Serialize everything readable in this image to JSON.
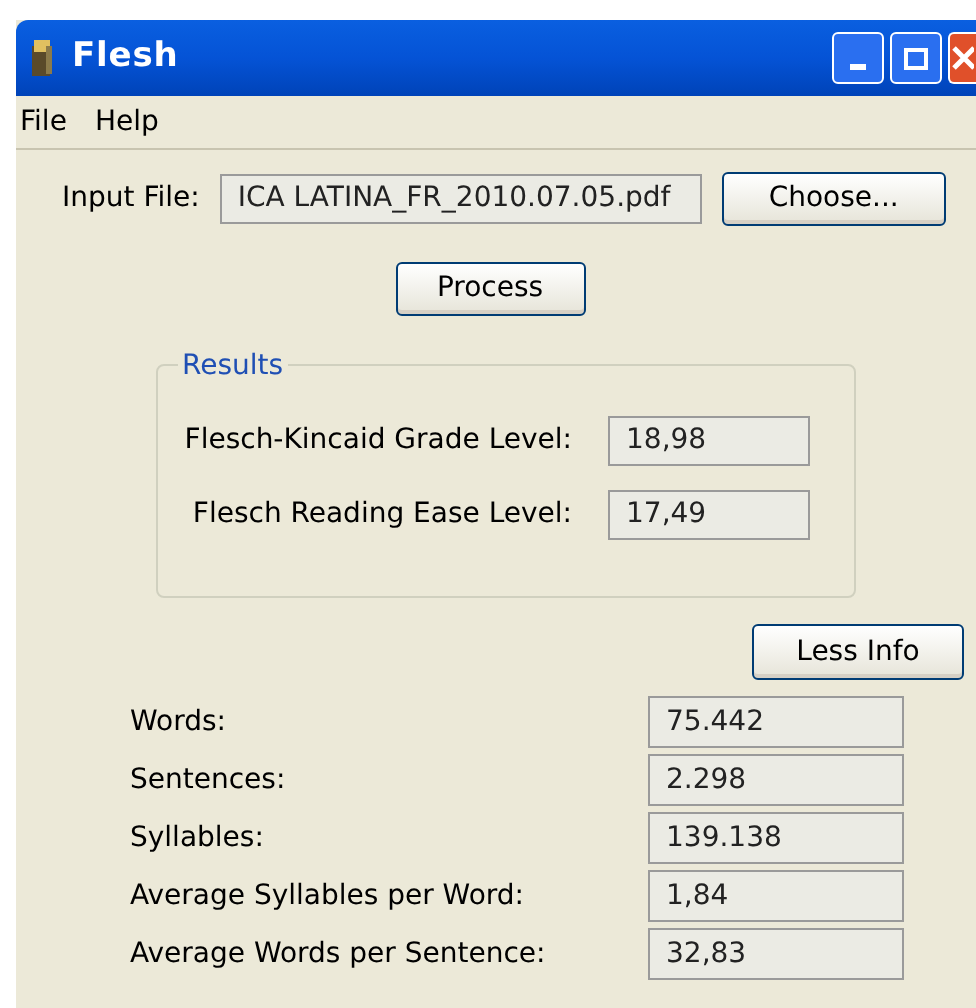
{
  "window": {
    "title": "Flesh"
  },
  "menu": [
    "File",
    "Help"
  ],
  "input_file": {
    "label": "Input File:",
    "value": "ICA LATINA_FR_2010.07.05.pdf",
    "button": "Choose..."
  },
  "process_button": "Process",
  "results": {
    "title": "Results",
    "rows": [
      {
        "label": "Flesch-Kincaid Grade Level:",
        "value": "18,98"
      },
      {
        "label": "Flesch Reading Ease Level:",
        "value": "17,49"
      }
    ]
  },
  "info_button": "Less Info",
  "stats": [
    {
      "label": "Words:",
      "value": "75.442"
    },
    {
      "label": "Sentences:",
      "value": "2.298"
    },
    {
      "label": "Syllables:",
      "value": "139.138"
    },
    {
      "label": "Average Syllables per Word:",
      "value": "1,84"
    },
    {
      "label": "Average Words per Sentence:",
      "value": "32,83"
    }
  ]
}
